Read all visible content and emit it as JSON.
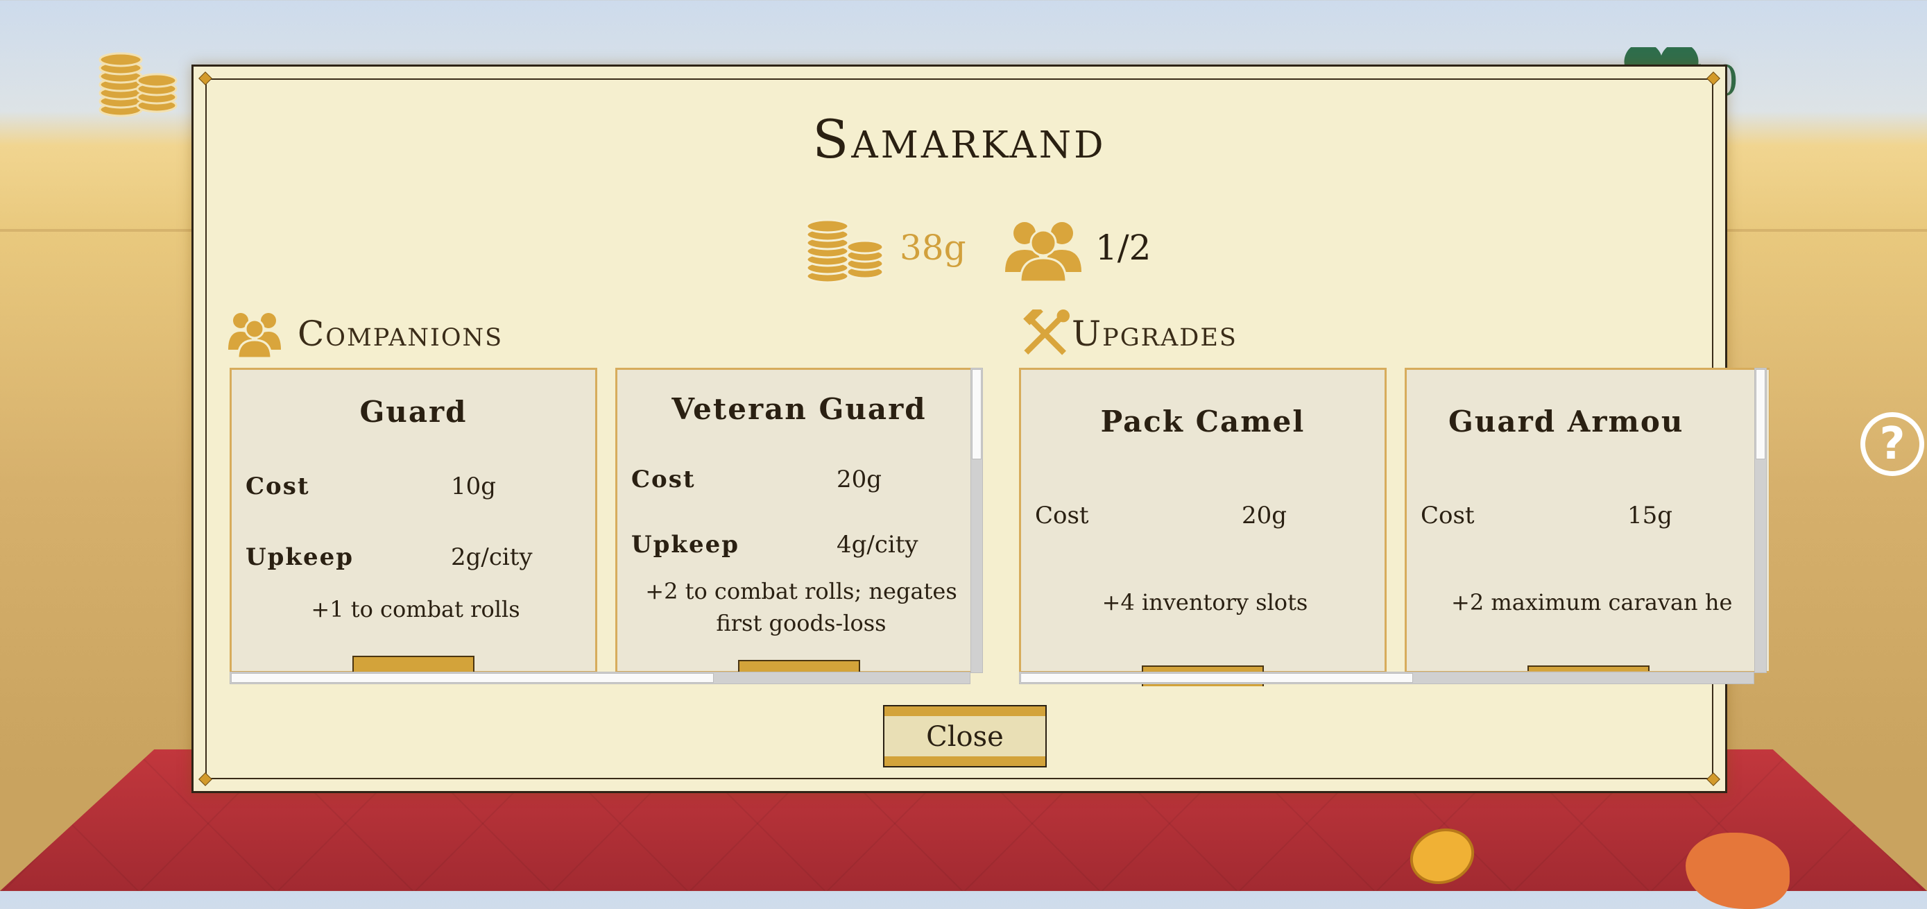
{
  "hud": {
    "gold_icon": "coins-icon",
    "health_icon": "heart-icon",
    "health_value": "10",
    "help_label": "?"
  },
  "dialog": {
    "title": "Samarkand",
    "gold": "38g",
    "party": "1/2",
    "close_label": "Close"
  },
  "companions": {
    "heading": "Companions",
    "cards": [
      {
        "name": "Guard",
        "cost_label": "Cost",
        "cost": "10g",
        "upkeep_label": "Upkeep",
        "upkeep": "2g/city",
        "effect": "+1 to combat rolls"
      },
      {
        "name": "Veteran Guard",
        "cost_label": "Cost",
        "cost": "20g",
        "upkeep_label": "Upkeep",
        "upkeep": "4g/city",
        "effect": "+2 to combat rolls; negates first goods-loss"
      }
    ]
  },
  "upgrades": {
    "heading": "Upgrades",
    "cards": [
      {
        "name": "Pack Camel",
        "cost_label": "Cost",
        "cost": "20g",
        "effect": "+4 inventory slots"
      },
      {
        "name": "Guard Armou",
        "cost_label": "Cost",
        "cost": "15g",
        "effect": "+2 maximum caravan he"
      }
    ]
  },
  "colors": {
    "accent_gold": "#d1a03c",
    "panel": "#f5efcf",
    "card": "#ebe6d4",
    "board_red": "#b8323a"
  }
}
